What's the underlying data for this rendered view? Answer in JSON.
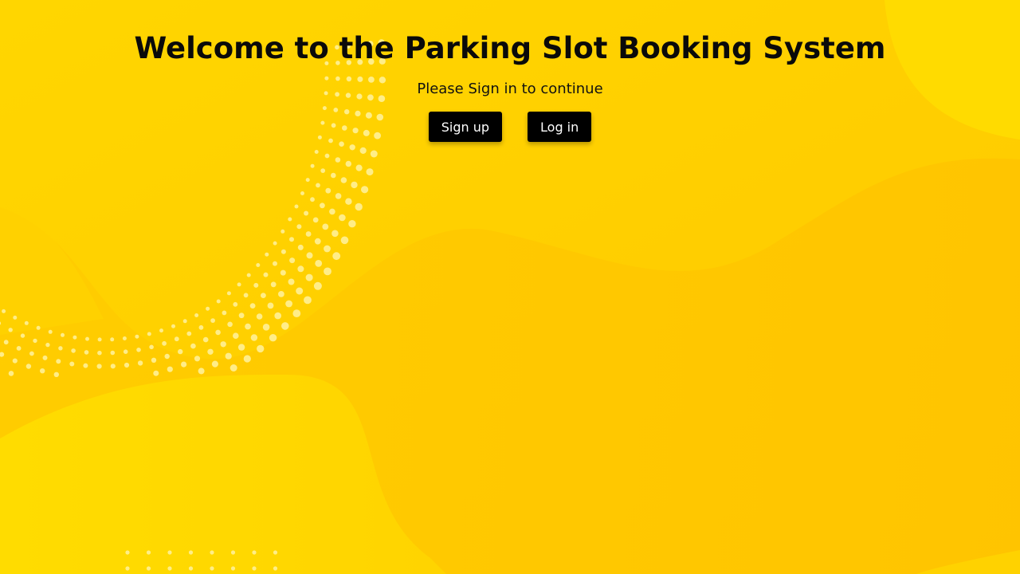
{
  "page": {
    "title": "Welcome to the Parking Slot Booking System",
    "subtitle": "Please Sign in to continue"
  },
  "actions": {
    "signup_label": "Sign up",
    "login_label": "Log in"
  },
  "colors": {
    "background": "#ffd500",
    "button_bg": "#000000",
    "button_text": "#ffffff",
    "title_text": "#0a0a0a"
  }
}
